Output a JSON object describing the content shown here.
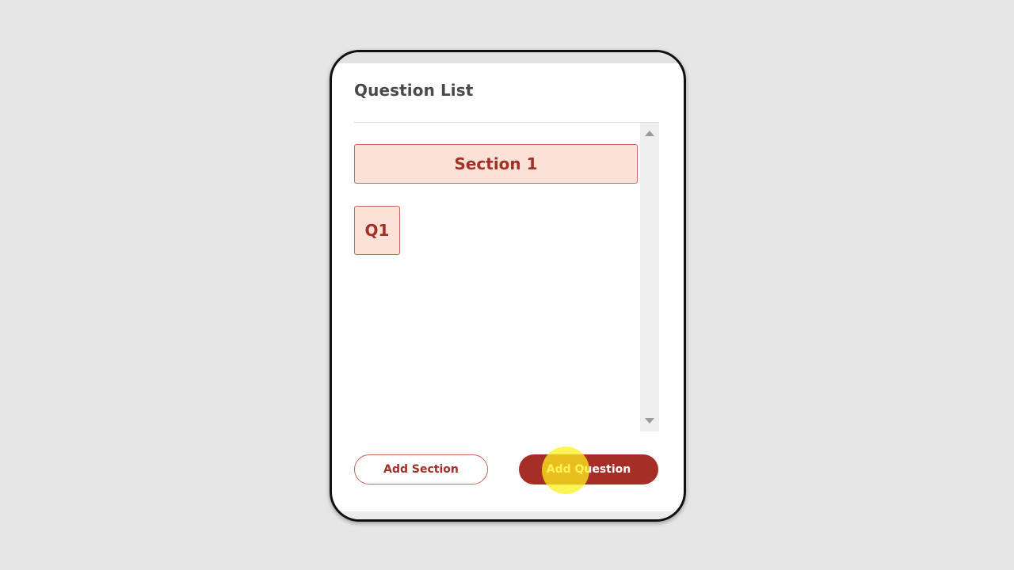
{
  "panel": {
    "title": "Question List"
  },
  "sections": [
    {
      "label": "Section 1",
      "questions": [
        {
          "label": "Q1"
        }
      ]
    }
  ],
  "actions": {
    "add_section_label": "Add Section",
    "add_question_label": "Add Question"
  },
  "colors": {
    "accent": "#a52f26",
    "tile_fill": "#fae3d6",
    "tile_border": "#c9655a",
    "click_indicator": "#fff01e"
  },
  "icons": {
    "scroll_up": "triangle-up-icon",
    "scroll_down": "triangle-down-icon"
  }
}
